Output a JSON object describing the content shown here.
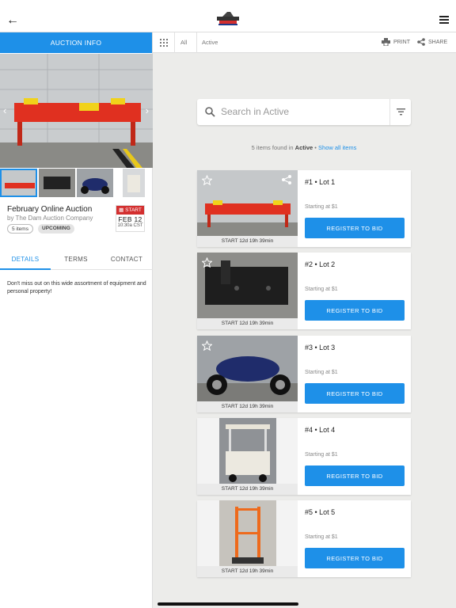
{
  "header": {
    "back_icon": "arrow-left-icon",
    "logo": "auction-company-logo",
    "menu_icon": "hamburger-menu-icon"
  },
  "left_panel": {
    "tab_label": "AUCTION INFO",
    "title": "February Online Auction",
    "byline": "by The Dam Auction Company",
    "items_chip": "5 items",
    "status_chip": "UPCOMING",
    "date": {
      "label": "START",
      "day": "FEB 12",
      "time": "10:30a CST"
    },
    "tabs": [
      "DETAILS",
      "TERMS",
      "CONTACT"
    ],
    "active_tab": "DETAILS",
    "description": "Don't miss out on this wide assortment of equipment and personal property!"
  },
  "breadcrumb": {
    "items": [
      "All",
      "Active"
    ],
    "print": "PRINT",
    "share": "SHARE"
  },
  "search": {
    "placeholder": "Search in Active"
  },
  "results": {
    "count_text": "5 items found in",
    "filter": "Active",
    "sep": "•",
    "show_all": "Show all items"
  },
  "lots": [
    {
      "label": "#1 • Lot 1",
      "starting": "Starting at $1",
      "button": "REGISTER TO BID",
      "time": "START 12d 19h 39min"
    },
    {
      "label": "#2 • Lot 2",
      "starting": "Starting at $1",
      "button": "REGISTER TO BID",
      "time": "START 12d 19h 39min"
    },
    {
      "label": "#3 • Lot 3",
      "starting": "Starting at $1",
      "button": "REGISTER TO BID",
      "time": "START 12d 19h 39min"
    },
    {
      "label": "#4 • Lot 4",
      "starting": "Starting at $1",
      "button": "REGISTER TO BID",
      "time": "START 12d 19h 39min"
    },
    {
      "label": "#5 • Lot 5",
      "starting": "Starting at $1",
      "button": "REGISTER TO BID",
      "time": "START 12d 19h 39min"
    }
  ],
  "colors": {
    "accent": "#1e90e8",
    "start_red": "#d32f2f",
    "background": "#ececea"
  }
}
